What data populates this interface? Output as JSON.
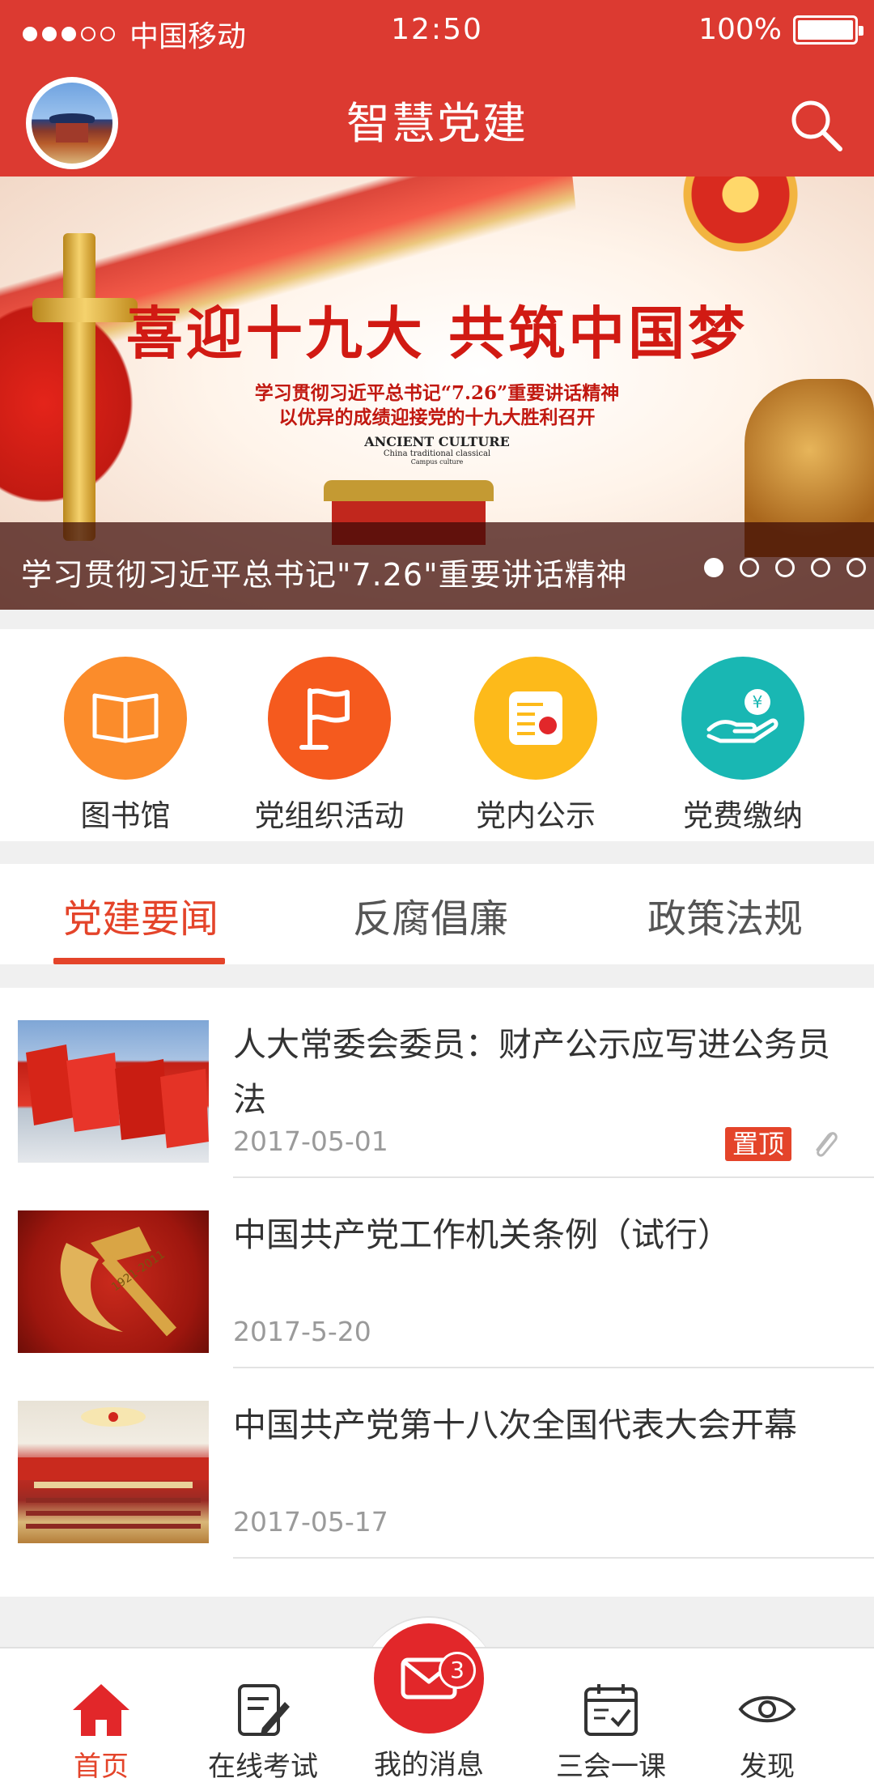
{
  "status_bar": {
    "carrier": "中国移动",
    "time": "12:50",
    "battery": "100%"
  },
  "header": {
    "title": "智慧党建",
    "search_icon": "search-icon",
    "avatar_icon": "temple-of-heaven-avatar"
  },
  "banner": {
    "headline": "喜迎十九大 共筑中国梦",
    "subtitle_line1": "学习贯彻习近平总书记“7.26”重要讲话精神",
    "subtitle_line2": "以优异的成绩迎接党的十九大胜利召开",
    "en_title": "ANCIENT CULTURE",
    "en_sub1": "China traditional classical",
    "en_sub2": "Campus culture",
    "caption": "学习贯彻习近平总书记\"7.26\"重要讲话精神",
    "page_count": 5,
    "active_page": 1
  },
  "quick_menu": [
    {
      "label": "图书馆",
      "icon": "book-icon",
      "color": "#fb8c2b"
    },
    {
      "label": "党组织活动",
      "icon": "flag-icon",
      "color": "#f55a1e"
    },
    {
      "label": "党内公示",
      "icon": "notice-icon",
      "color": "#fdba1a"
    },
    {
      "label": "党费缴纳",
      "icon": "payment-hand-icon",
      "color": "#19b7b3"
    }
  ],
  "tabs": [
    {
      "label": "党建要闻",
      "active": true
    },
    {
      "label": "反腐倡廉",
      "active": false
    },
    {
      "label": "政策法规",
      "active": false
    }
  ],
  "news": [
    {
      "title": "人大常委会委员：财产公示应写进公务员法",
      "date": "2017-05-01",
      "badge": "置顶",
      "has_attachment": true
    },
    {
      "title": "中国共产党工作机关条例（试行）",
      "date": "2017-5-20"
    },
    {
      "title": "中国共产党第十八次全国代表大会开幕",
      "date": "2017-05-17"
    }
  ],
  "bottom_nav": [
    {
      "label": "首页",
      "icon": "home-icon",
      "active": true
    },
    {
      "label": "在线考试",
      "icon": "exam-icon",
      "active": false
    },
    {
      "label": "我的消息",
      "icon": "mail-icon",
      "active": false,
      "badge": "3"
    },
    {
      "label": "三会一课",
      "icon": "calendar-icon",
      "active": false
    },
    {
      "label": "发现",
      "icon": "eye-icon",
      "active": false
    }
  ],
  "colors": {
    "primary_red": "#dc3a31",
    "accent": "#e4442a"
  }
}
